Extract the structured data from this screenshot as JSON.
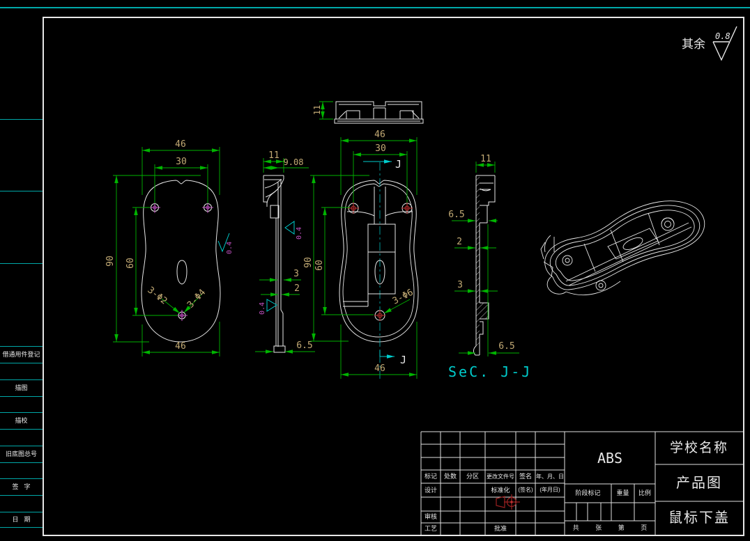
{
  "frame": {
    "surface_note": "其余",
    "surface_roughness": "0.8"
  },
  "margin_strip": {
    "labels": [
      "借通用件登记",
      "描图",
      "描校",
      "旧底图总号",
      "签字",
      "日期"
    ]
  },
  "views": {
    "outer_plan": {
      "dim_width_top": "46",
      "dim_hole_span": "30",
      "dim_height": "90",
      "dim_hole_height": "60",
      "dim_width_bottom": "46",
      "leader_pilot_holes": "3-Φ2",
      "leader_cbore_holes": "3-Φ4",
      "finish_value": "0.4"
    },
    "side_profile": {
      "dim_width": "11",
      "dim_offset": "9.08",
      "dim_rib": "3",
      "dim_wall": "2",
      "dim_base": "6.5",
      "finish_right": "0.4",
      "finish_left": "0.4"
    },
    "inner_plan": {
      "dim_top_height": "11",
      "dim_width_top": "46",
      "dim_hole_span": "30",
      "dim_height": "90",
      "dim_hole_height": "60",
      "leader_boss_holes": "3-Φ6",
      "dim_width_bottom": "46",
      "section_mark_top": "J",
      "section_mark_bottom": "J"
    },
    "section_jj": {
      "dim_width": "11",
      "dim_top_depth": "6.5",
      "dim_wall": "2",
      "dim_rib": "3",
      "dim_base": "6.5",
      "caption": "SeC. J-J"
    }
  },
  "title_block": {
    "material": "ABS",
    "school_name": "学校名称",
    "drawing_type": "产品图",
    "part_name": "鼠标下盖",
    "revision_header": [
      "标记",
      "处数",
      "分区",
      "更改文件号",
      "签名",
      "年、月、日"
    ],
    "role_design": "设计",
    "role_standardization": "标准化",
    "signature_hint": "(签名)",
    "date_hint": "(年月日)",
    "role_review": "审核",
    "role_process": "工艺",
    "role_approve": "批准",
    "stage_label": "阶段标记",
    "weight_label": "重量",
    "scale_label": "比例",
    "pages": [
      "共",
      "张",
      "第",
      "页"
    ]
  }
}
